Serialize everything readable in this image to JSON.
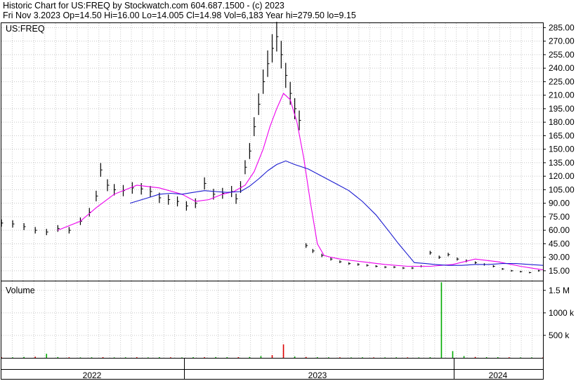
{
  "header": {
    "line1": "Historic Chart for US:FREQ by Stockwatch.com 604.687.1500 - (c) 2023",
    "line2": "Fri Nov  3.2023   Op=14.50   Hi=16.00   Lo=14.005   Cl=14.98   Vol=6,183   Year hi=279.50   lo=9.15"
  },
  "colors": {
    "price_bars": "#000000",
    "ma_short": "#ee00ee",
    "ma_long": "#1a1ad0",
    "volume_up": "#00aa00",
    "volume_down": "#dd0000",
    "grid": "#c8c8c8",
    "frame": "#000000"
  },
  "chart_data": [
    {
      "type": "line",
      "title": "US:FREQ",
      "y_ticks": [
        "285.00",
        "270.00",
        "255.00",
        "240.00",
        "225.00",
        "210.00",
        "195.00",
        "180.00",
        "165.00",
        "150.00",
        "135.00",
        "120.00",
        "105.00",
        "90.00",
        "75.00",
        "60.00",
        "45.00",
        "30.00",
        "15.00"
      ],
      "ylim": [
        4,
        290
      ],
      "x_labels": [
        "2022",
        "2023",
        "2024"
      ],
      "xlim": [
        0,
        24
      ],
      "series": [
        {
          "style": "bars",
          "x": [
            0,
            0.5,
            1,
            1.5,
            2,
            2.5,
            3,
            3.5,
            3.9,
            4.2,
            4.4,
            4.7,
            5,
            5.4,
            5.8,
            6.2,
            6.6,
            7,
            7.4,
            7.8,
            8.2,
            8.6,
            9,
            9.4,
            9.8,
            10.2,
            10.4,
            10.6,
            10.8,
            11,
            11.2,
            11.4,
            11.6,
            11.8,
            12,
            12.2,
            12.4,
            12.6,
            12.8,
            13,
            13.2,
            13.5,
            13.8,
            14.2,
            14.6,
            15,
            15.4,
            15.8,
            16.2,
            16.6,
            17,
            17.4,
            17.8,
            18.2,
            18.6,
            19,
            19.4,
            19.8,
            20.2,
            20.6,
            21,
            21.4,
            21.8,
            22.2,
            22.6,
            23,
            23.4,
            23.8
          ],
          "values": [
            68,
            67,
            64,
            60,
            58,
            62,
            60,
            70,
            80,
            98,
            127,
            110,
            105,
            104,
            107,
            106,
            103,
            96,
            94,
            92,
            87,
            90,
            112,
            100,
            101,
            103,
            95,
            108,
            130,
            148,
            175,
            200,
            225,
            245,
            262,
            275,
            255,
            232,
            212,
            195,
            182,
            43,
            37,
            32,
            28,
            25,
            23,
            22,
            21,
            20,
            19,
            19,
            18,
            18,
            20,
            35,
            30,
            33,
            28,
            26,
            24,
            22,
            20,
            17,
            15,
            14,
            13,
            15
          ]
        },
        {
          "style": "line",
          "name": "",
          "x": [
            2.5,
            3.5,
            4.2,
            5,
            6,
            7,
            8,
            8.6,
            9.2,
            9.8,
            10.3,
            10.8,
            11.2,
            11.6,
            11.9,
            12.2,
            12.5,
            12.8,
            13.1,
            13.4,
            13.7,
            14,
            14.3,
            14.6,
            15,
            16,
            17,
            18,
            19,
            20,
            21,
            22,
            23,
            24
          ],
          "values": [
            60,
            70,
            85,
            100,
            110,
            107,
            100,
            92,
            94,
            100,
            103,
            110,
            125,
            150,
            175,
            195,
            212,
            205,
            180,
            140,
            90,
            45,
            32,
            30,
            28,
            25,
            22,
            20,
            20,
            22,
            28,
            25,
            20,
            16
          ]
        },
        {
          "style": "line",
          "name": "",
          "x": [
            5.7,
            6.5,
            7,
            7.5,
            8,
            8.5,
            9,
            9.5,
            10,
            10.6,
            11,
            11.4,
            11.8,
            12.2,
            12.6,
            13,
            13.6,
            14.2,
            14.8,
            15.4,
            16,
            16.6,
            17.2,
            17.6,
            18,
            18.3,
            18.8,
            19.2,
            19.8,
            20.4,
            21,
            21.6,
            22.2,
            22.8,
            23.4,
            24
          ],
          "values": [
            90,
            96,
            100,
            101,
            100,
            102,
            104,
            103,
            102,
            103,
            109,
            117,
            126,
            133,
            137,
            133,
            128,
            120,
            112,
            104,
            92,
            77,
            58,
            45,
            33,
            24,
            23,
            22,
            21,
            21,
            22,
            22,
            23,
            23,
            22,
            21
          ]
        }
      ]
    },
    {
      "type": "bar",
      "title": "Volume",
      "y_ticks": [
        "1.5 M",
        "1000 k",
        "500 k"
      ],
      "ylim": [
        0,
        1700000
      ],
      "x": [
        0,
        0.5,
        1,
        1.5,
        2,
        2.5,
        3,
        3.5,
        4,
        4.5,
        5,
        5.5,
        6,
        6.5,
        7,
        7.5,
        8,
        8.5,
        9,
        9.5,
        10,
        10.5,
        11,
        11.5,
        12,
        12.5,
        13,
        13.5,
        14,
        14.5,
        15,
        15.5,
        16,
        16.5,
        17,
        17.5,
        18,
        18.5,
        19,
        19.5,
        20,
        20.5,
        21,
        21.5,
        22,
        22.5,
        23,
        23.5,
        24
      ],
      "values": [
        15000,
        12000,
        20000,
        25000,
        90000,
        18000,
        12000,
        10000,
        12000,
        15000,
        10000,
        12000,
        14000,
        10000,
        15000,
        12000,
        10000,
        15000,
        14000,
        18000,
        15000,
        15000,
        20000,
        40000,
        60000,
        300000,
        30000,
        20000,
        15000,
        12000,
        12000,
        10000,
        12000,
        10000,
        10000,
        12000,
        10000,
        10000,
        15000,
        1680000,
        150000,
        40000,
        20000,
        15000,
        15000,
        12000,
        10000,
        10000,
        10000
      ]
    }
  ]
}
